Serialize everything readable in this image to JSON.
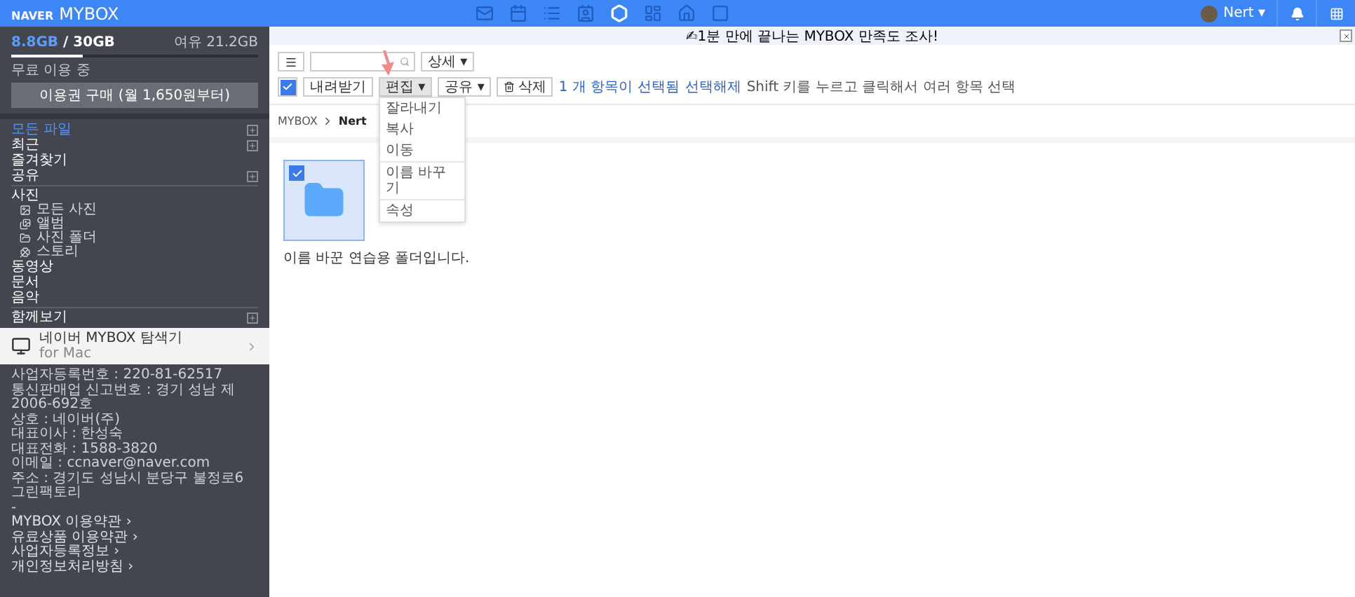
{
  "header": {
    "logo_brand": "NAVER",
    "logo_product": "MYBOX",
    "services": [
      {
        "kind": "mail",
        "selected": false
      },
      {
        "kind": "calendar",
        "selected": false
      },
      {
        "kind": "list",
        "selected": false
      },
      {
        "kind": "contacts",
        "selected": false
      },
      {
        "kind": "box",
        "selected": true
      },
      {
        "kind": "memo",
        "selected": false
      },
      {
        "kind": "cafe",
        "selected": false
      },
      {
        "kind": "square",
        "selected": false
      }
    ],
    "user": "Nert",
    "caret": "▾"
  },
  "notice": {
    "text": "✍1분 만에 끝나는 MYBOX 만족도 조사!"
  },
  "sidebar": {
    "storage": {
      "used": "8.8GB",
      "total": "/ 30GB",
      "free": "여유 21.2GB",
      "level": 0.29,
      "plan": "무료 이용 중",
      "buy_button": "이용권 구매 (월 1,650원부터)"
    },
    "items": [
      {
        "label": "모든 파일",
        "selected": true,
        "expandable": true
      },
      {
        "label": "최근",
        "selected": false,
        "expandable": true
      },
      {
        "label": "즐겨찾기",
        "selected": false,
        "expandable": false
      },
      {
        "label": "공유",
        "selected": false,
        "expandable": true
      }
    ],
    "photos": {
      "label": "사진",
      "children": [
        {
          "label": "모든 사진",
          "kind": "photo"
        },
        {
          "label": "앨범",
          "kind": "album"
        },
        {
          "label": "사진 폴더",
          "kind": "folder"
        },
        {
          "label": "스토리",
          "kind": "story"
        }
      ]
    },
    "media": [
      {
        "label": "동영상"
      },
      {
        "label": "문서"
      },
      {
        "label": "음악"
      }
    ],
    "together": {
      "label": "함께보기"
    },
    "app_promo": {
      "title": "네이버 MYBOX 탐색기",
      "subtitle": "for Mac"
    },
    "footer": [
      "사업자등록번호 : 220-81-62517",
      "통신판매업 신고번호 : 경기 성남 제 2006-692호",
      "상호 : 네이버(주)",
      "대표이사 : 한성숙",
      "대표전화 : 1588-3820",
      "이메일 : ccnaver@naver.com",
      "주소 : 경기도 성남시 분당구 불정로6 그린팩토리",
      "-"
    ],
    "links": [
      "MYBOX 이용약관 ›",
      "유료상품 이용약관 ›",
      "사업자등록정보 ›",
      "개인정보처리방침 ›"
    ]
  },
  "toolbar": {
    "detail": "상세 ▾",
    "select_all_checked": true,
    "buttons": [
      {
        "label": "내려받기",
        "kind": "plain"
      },
      {
        "label": "편집 ▾",
        "kind": "menu",
        "expanded": true
      },
      {
        "label": "공유 ▾",
        "kind": "menu",
        "expanded": false
      },
      {
        "label": "삭제",
        "kind": "delete"
      }
    ],
    "selection_count": "1 개 항목이 선택됨",
    "deselect": "선택해제",
    "hint": "Shift 키를 누르고 클릭해서 여러 항목 선택",
    "edit_menu": [
      [
        "잘라내기",
        "복사",
        "이동"
      ],
      [
        "이름 바꾸기"
      ],
      [
        "속성"
      ]
    ]
  },
  "breadcrumb": [
    "MYBOX",
    "Nert"
  ],
  "files": [
    {
      "name": "이름 바꾼 연습용 폴더입니다.",
      "selected": true
    }
  ]
}
